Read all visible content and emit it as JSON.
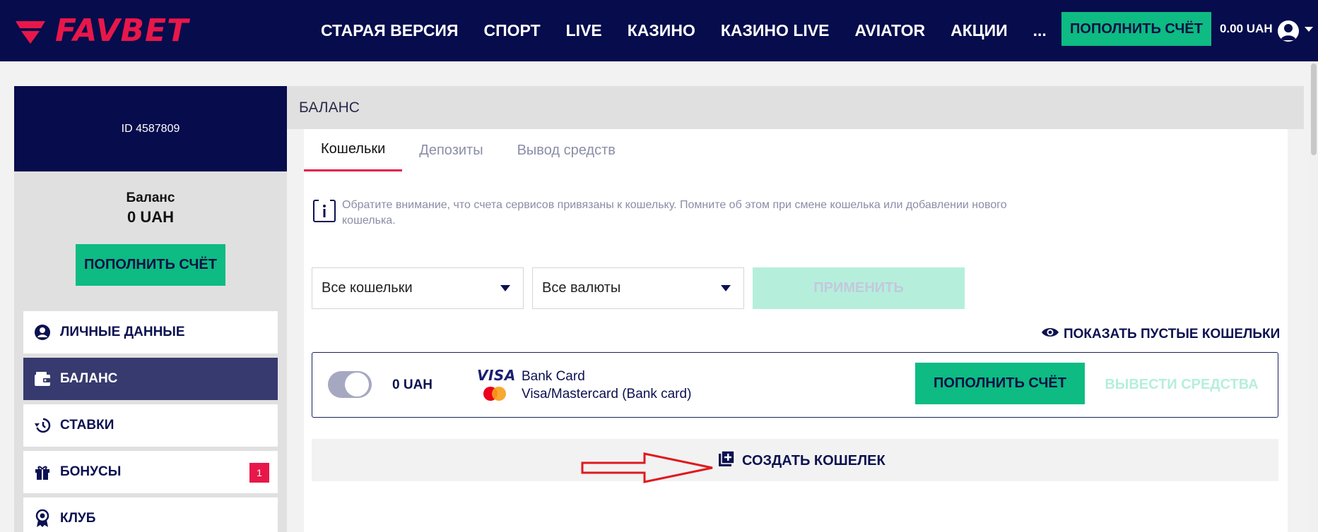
{
  "header": {
    "logo_text": "FAVBET",
    "nav": [
      "СТАРАЯ ВЕРСИЯ",
      "СПОРТ",
      "LIVE",
      "КАЗИНО",
      "КАЗИНО LIVE",
      "AVIATOR",
      "АКЦИИ"
    ],
    "more": "...",
    "deposit_label": "ПОПОЛНИТЬ СЧЁТ",
    "balance": "0.00 UAH",
    "brand_color": "#e8174a",
    "bg_color": "#060c4c",
    "accent_green": "#0dbb83"
  },
  "sidebar": {
    "user_id": "ID 4587809",
    "balance_label": "Баланс",
    "balance_value": "0 UAH",
    "deposit_label": "ПОПОЛНИТЬ СЧЁТ",
    "items": [
      {
        "label": "ЛИЧНЫЕ ДАННЫЕ",
        "icon": "user-icon"
      },
      {
        "label": "БАЛАНС",
        "icon": "wallet-icon",
        "active": true
      },
      {
        "label": "СТАВКИ",
        "icon": "history-icon"
      },
      {
        "label": "БОНУСЫ",
        "icon": "gift-icon",
        "badge": "1"
      },
      {
        "label": "КЛУБ",
        "icon": "award-icon"
      }
    ]
  },
  "main": {
    "title": "БАЛАНС",
    "tabs": [
      "Кошельки",
      "Депозиты",
      "Вывод средств"
    ],
    "active_tab": "Кошельки",
    "notice": "Обратите внимание, что счета сервисов привязаны к кошельку. Помните об этом при смене кошелька или добавлении нового кошелька.",
    "filter_wallets": "Все кошельки",
    "filter_currencies": "Все валюты",
    "apply_label": "ПРИМЕНИТЬ",
    "show_empty_label": "ПОКАЗАТЬ ПУСТЫЕ КОШЕЛЬКИ",
    "wallet": {
      "amount": "0 UAH",
      "card_brand": "VISA",
      "method_title": "Bank Card",
      "method_subtitle": "Visa/Mastercard (Bank card)",
      "deposit_label": "ПОПОЛНИТЬ СЧЁТ",
      "withdraw_label": "ВЫВЕСТИ СРЕДСТВА"
    },
    "create_wallet_label": "СОЗДАТЬ КОШЕЛЕК"
  }
}
